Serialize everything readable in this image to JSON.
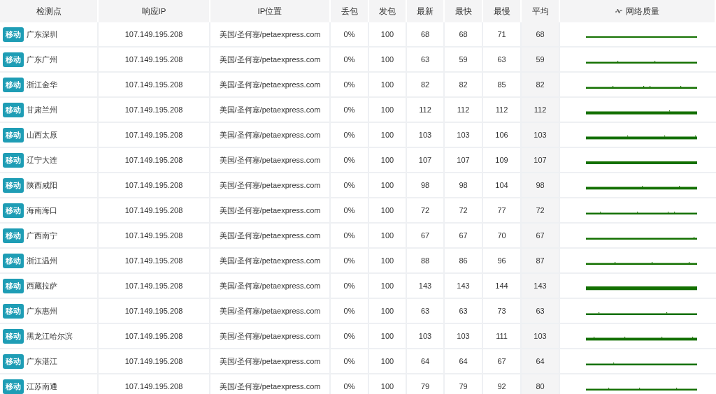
{
  "table": {
    "columns": [
      "检测点",
      "响应IP",
      "IP位置",
      "丢包",
      "发包",
      "最新",
      "最快",
      "最慢",
      "平均",
      "网络质量"
    ],
    "rows": [
      {
        "carrier": "移动",
        "location": "广东深圳",
        "ip": "107.149.195.208",
        "ip_location": "美国/圣何塞/petaexpress.com",
        "loss": "0%",
        "sent": "100",
        "latest": "68",
        "fastest": "68",
        "slowest": "71",
        "average": "68"
      },
      {
        "carrier": "移动",
        "location": "广东广州",
        "ip": "107.149.195.208",
        "ip_location": "美国/圣何塞/petaexpress.com",
        "loss": "0%",
        "sent": "100",
        "latest": "63",
        "fastest": "59",
        "slowest": "63",
        "average": "59"
      },
      {
        "carrier": "移动",
        "location": "浙江金华",
        "ip": "107.149.195.208",
        "ip_location": "美国/圣何塞/petaexpress.com",
        "loss": "0%",
        "sent": "100",
        "latest": "82",
        "fastest": "82",
        "slowest": "85",
        "average": "82"
      },
      {
        "carrier": "移动",
        "location": "甘肃兰州",
        "ip": "107.149.195.208",
        "ip_location": "美国/圣何塞/petaexpress.com",
        "loss": "0%",
        "sent": "100",
        "latest": "112",
        "fastest": "112",
        "slowest": "112",
        "average": "112"
      },
      {
        "carrier": "移动",
        "location": "山西太原",
        "ip": "107.149.195.208",
        "ip_location": "美国/圣何塞/petaexpress.com",
        "loss": "0%",
        "sent": "100",
        "latest": "103",
        "fastest": "103",
        "slowest": "106",
        "average": "103"
      },
      {
        "carrier": "移动",
        "location": "辽宁大连",
        "ip": "107.149.195.208",
        "ip_location": "美国/圣何塞/petaexpress.com",
        "loss": "0%",
        "sent": "100",
        "latest": "107",
        "fastest": "107",
        "slowest": "109",
        "average": "107"
      },
      {
        "carrier": "移动",
        "location": "陕西咸阳",
        "ip": "107.149.195.208",
        "ip_location": "美国/圣何塞/petaexpress.com",
        "loss": "0%",
        "sent": "100",
        "latest": "98",
        "fastest": "98",
        "slowest": "104",
        "average": "98"
      },
      {
        "carrier": "移动",
        "location": "海南海口",
        "ip": "107.149.195.208",
        "ip_location": "美国/圣何塞/petaexpress.com",
        "loss": "0%",
        "sent": "100",
        "latest": "72",
        "fastest": "72",
        "slowest": "77",
        "average": "72"
      },
      {
        "carrier": "移动",
        "location": "广西南宁",
        "ip": "107.149.195.208",
        "ip_location": "美国/圣何塞/petaexpress.com",
        "loss": "0%",
        "sent": "100",
        "latest": "67",
        "fastest": "67",
        "slowest": "70",
        "average": "67"
      },
      {
        "carrier": "移动",
        "location": "浙江温州",
        "ip": "107.149.195.208",
        "ip_location": "美国/圣何塞/petaexpress.com",
        "loss": "0%",
        "sent": "100",
        "latest": "88",
        "fastest": "86",
        "slowest": "96",
        "average": "87"
      },
      {
        "carrier": "移动",
        "location": "西藏拉萨",
        "ip": "107.149.195.208",
        "ip_location": "美国/圣何塞/petaexpress.com",
        "loss": "0%",
        "sent": "100",
        "latest": "143",
        "fastest": "143",
        "slowest": "144",
        "average": "143"
      },
      {
        "carrier": "移动",
        "location": "广东惠州",
        "ip": "107.149.195.208",
        "ip_location": "美国/圣何塞/petaexpress.com",
        "loss": "0%",
        "sent": "100",
        "latest": "63",
        "fastest": "63",
        "slowest": "73",
        "average": "63"
      },
      {
        "carrier": "移动",
        "location": "黑龙江哈尔滨",
        "ip": "107.149.195.208",
        "ip_location": "美国/圣何塞/petaexpress.com",
        "loss": "0%",
        "sent": "100",
        "latest": "103",
        "fastest": "103",
        "slowest": "111",
        "average": "103"
      },
      {
        "carrier": "移动",
        "location": "广东湛江",
        "ip": "107.149.195.208",
        "ip_location": "美国/圣何塞/petaexpress.com",
        "loss": "0%",
        "sent": "100",
        "latest": "64",
        "fastest": "64",
        "slowest": "67",
        "average": "64"
      },
      {
        "carrier": "移动",
        "location": "江苏南通",
        "ip": "107.149.195.208",
        "ip_location": "美国/圣何塞/petaexpress.com",
        "loss": "0%",
        "sent": "100",
        "latest": "79",
        "fastest": "79",
        "slowest": "92",
        "average": "80"
      }
    ]
  }
}
